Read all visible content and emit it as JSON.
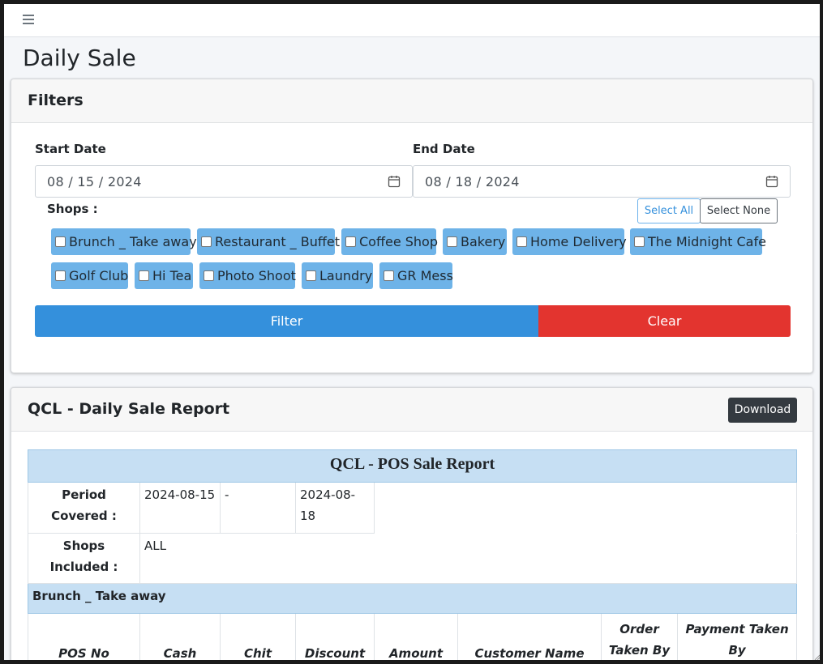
{
  "page": {
    "title": "Daily Sale"
  },
  "filters": {
    "title": "Filters",
    "start_label": "Start Date",
    "start_value": "08 / 15 / 2024",
    "end_label": "End Date",
    "end_value": "08 / 18 / 2024",
    "shops_label": "Shops :",
    "select_all": "Select All",
    "select_none": "Select None",
    "shops": [
      "Brunch _ Take away",
      "Restaurant _ Buffet",
      "Coffee Shop",
      "Bakery",
      "Home Delivery",
      "The Midnight Cafe",
      "Golf Club",
      "Hi Tea",
      "Photo Shoot",
      "Laundry",
      "GR Mess"
    ],
    "filter_button": "Filter",
    "clear_button": "Clear",
    "colors": {
      "filter": "#3490dc",
      "clear": "#e3342f",
      "shop_chip": "#6eb3e8"
    }
  },
  "report": {
    "title": "QCL - Daily Sale Report",
    "download": "Download",
    "table_title": "QCL - POS Sale Report",
    "period_label": "Period Covered :",
    "period_start": "2024-08-15",
    "period_sep": "-",
    "period_end": "2024-08-18",
    "shops_label": "Shops Included :",
    "shops_value": "ALL",
    "shop_section": "Brunch _ Take away",
    "columns": [
      "POS No",
      "Cash",
      "Chit",
      "Discount",
      "Amount",
      "Customer Name",
      "Order Taken By",
      "Payment Taken By"
    ]
  }
}
